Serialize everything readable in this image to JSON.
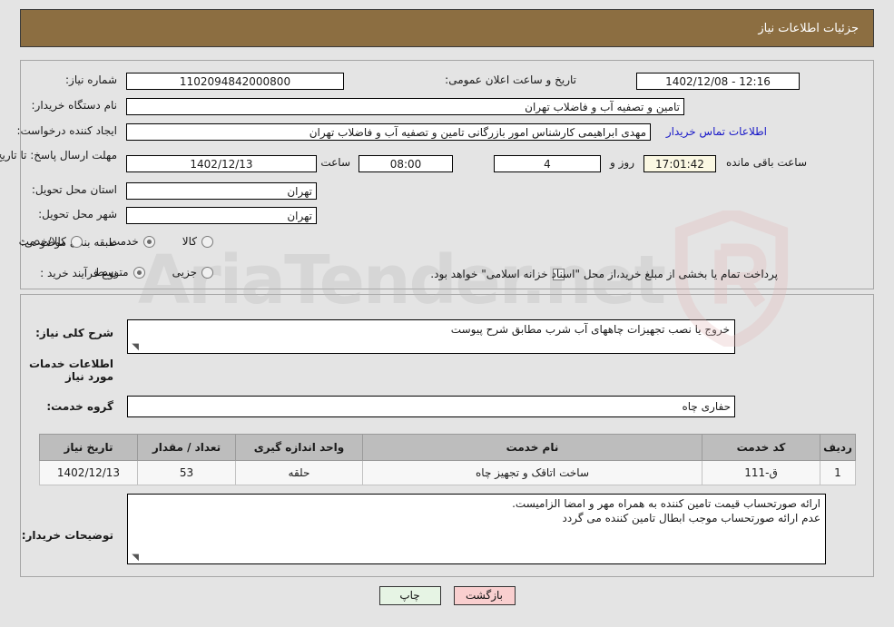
{
  "header": {
    "title": "جزئیات اطلاعات نیاز"
  },
  "watermark": {
    "text": "AriaTender.net",
    "shield_color": "#e3b7b7",
    "text_color": "#bdbdbd"
  },
  "summary": {
    "need_number_label": "شماره نیاز:",
    "need_number_value": "1102094842000800",
    "announce_datetime_label": "تاریخ و ساعت اعلان عمومی:",
    "announce_datetime_value": "1402/12/08 - 12:16",
    "buyer_org_label": "نام دستگاه خریدار:",
    "buyer_org_value": "تامین و تصفیه آب و فاضلاب تهران",
    "requester_label": "ایجاد کننده درخواست:",
    "requester_value": "مهدی ابراهیمی کارشناس امور بازرگانی تامین و تصفیه آب و فاضلاب تهران",
    "contact_link": "اطلاعات تماس خریدار",
    "deadline_label": "مهلت ارسال پاسخ: تا تاریخ:",
    "deadline_date": "1402/12/13",
    "deadline_time_label": "ساعت",
    "deadline_time": "08:00",
    "remaining_days": "4",
    "remaining_days_label": "روز و",
    "remaining_time": "17:01:42",
    "remaining_time_label": "ساعت باقی مانده",
    "province_label": "استان محل تحویل:",
    "province_value": "تهران",
    "city_label": "شهر محل تحویل:",
    "city_value": "تهران",
    "category_label": "طبقه بندی موضوعی:",
    "category_options": [
      {
        "label": "کالا",
        "selected": false
      },
      {
        "label": "خدمت",
        "selected": true
      },
      {
        "label": "کالا/خدمت",
        "selected": false
      }
    ],
    "process_label": "نوع فرآیند خرید :",
    "process_options": [
      {
        "label": "جزیی",
        "selected": false
      },
      {
        "label": "متوسط",
        "selected": true
      }
    ],
    "treasury_checkbox_checked": false,
    "treasury_note": "پرداخت تمام یا بخشی از مبلغ خرید،از محل \"اسناد خزانه اسلامی\" خواهد بود."
  },
  "need_description": {
    "label": "شرح کلی نیاز:",
    "value": "خروج یا نصب تجهیزات چاههای آب شرب مطابق شرح پیوست"
  },
  "services_section": {
    "heading": "اطلاعات خدمات مورد نیاز",
    "group_label": "گروه خدمت:",
    "group_value": "حفاری چاه"
  },
  "items_table": {
    "columns": [
      "ردیف",
      "کد خدمت",
      "نام خدمت",
      "واحد اندازه گیری",
      "تعداد / مقدار",
      "تاریخ نیاز"
    ],
    "rows": [
      {
        "row_no": "1",
        "service_code": "ق-111",
        "service_name": "ساخت اتاقک و تجهیز چاه",
        "unit": "حلقه",
        "quantity": "53",
        "need_date": "1402/12/13"
      }
    ]
  },
  "buyer_notes": {
    "label": "توضیحات خریدار:",
    "line1": "ارائه صورتحساب قیمت تامین کننده به همراه مهر و امضا الزامیست.",
    "line2": "عدم ارائه صورتحساب موجب ابطال تامین کننده می گردد"
  },
  "footer": {
    "print_label": "چاپ",
    "back_label": "بازگشت"
  }
}
